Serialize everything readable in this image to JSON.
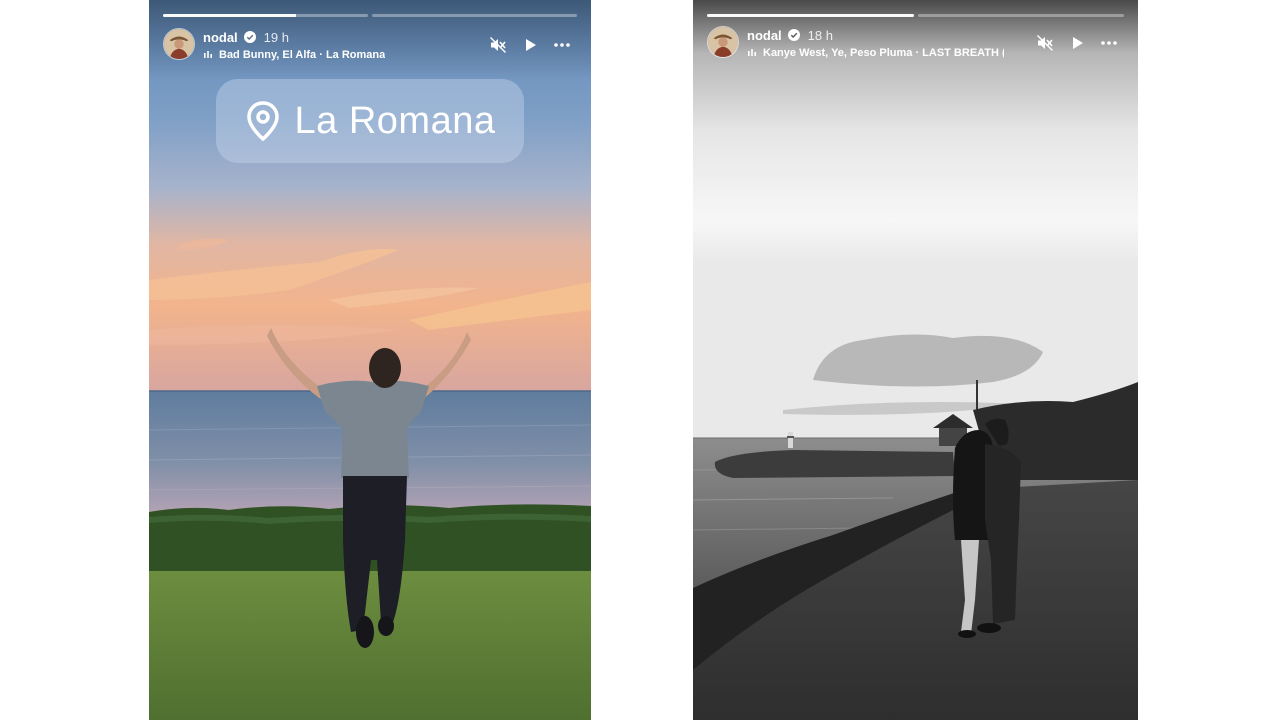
{
  "stories": [
    {
      "username": "nodal",
      "verified": true,
      "time": "19 h",
      "music": "Bad Bunny, El Alfa · La Romana",
      "progress": [
        0.65,
        0.0
      ],
      "location_sticker": {
        "label": "La Romana",
        "icon": "location-pin-icon"
      },
      "controls": [
        "mute-icon",
        "play-icon",
        "more-icon"
      ]
    },
    {
      "username": "nodal",
      "verified": true,
      "time": "18 h",
      "music": "Kanye West, Ye, Peso Pluma · LAST BREATH (fe",
      "progress": [
        1.0,
        0.0
      ],
      "controls": [
        "mute-icon",
        "play-icon",
        "more-icon"
      ]
    }
  ],
  "colors": {
    "progress_fill": "#ffffff",
    "sticker_bg": "#c8d7eb"
  }
}
